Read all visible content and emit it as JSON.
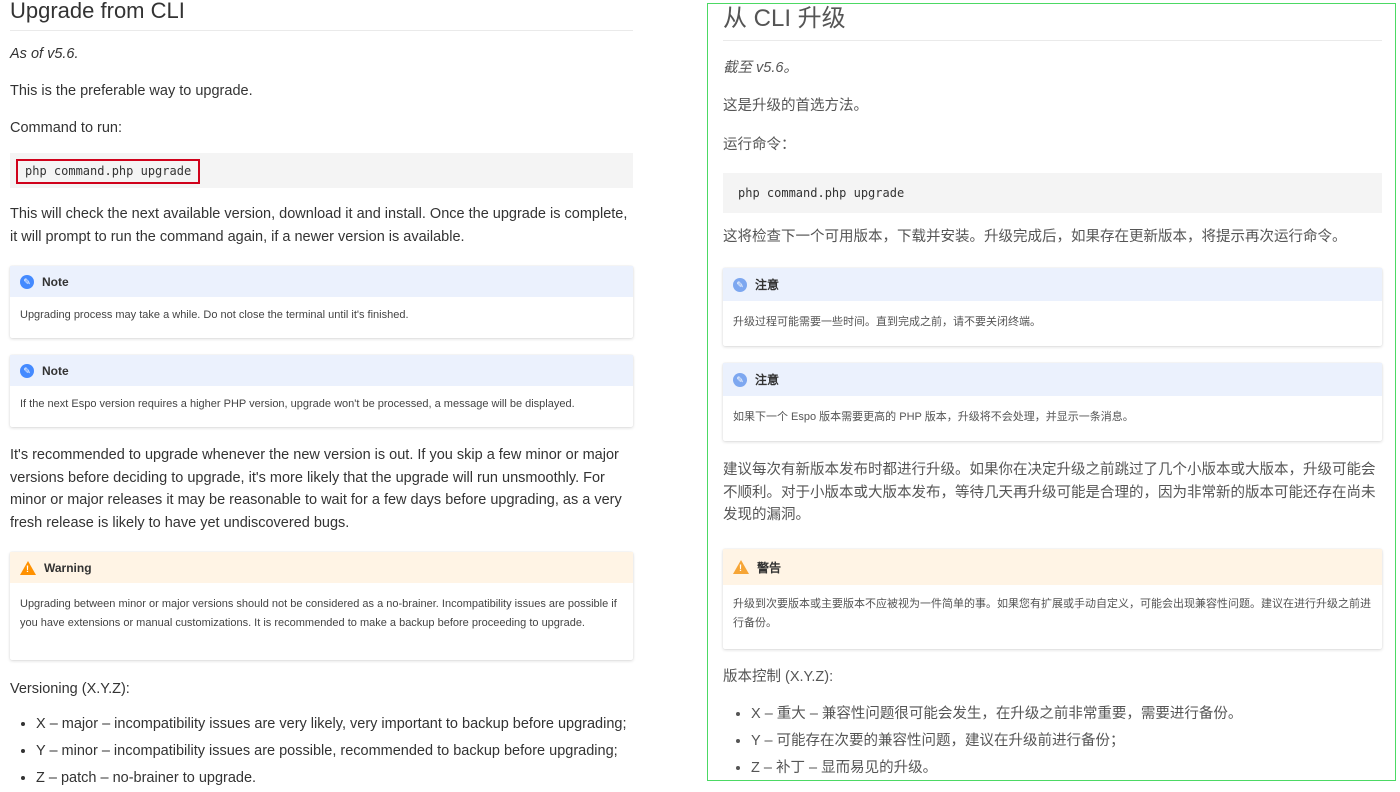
{
  "english": {
    "title": "Upgrade from CLI",
    "as_of": "As of v5.6.",
    "preferable": "This is the preferable way to upgrade.",
    "command_to_run": "Command to run:",
    "command": "php command.php upgrade",
    "check_text": "This will check the next available version, download it and install. Once the upgrade is complete, it will prompt to run the command again, if a newer version is available.",
    "note1": {
      "title": "Note",
      "body": "Upgrading process may take a while. Do not close the terminal until it's finished."
    },
    "note2": {
      "title": "Note",
      "body": "If the next Espo version requires a higher PHP version, upgrade won't be processed, a message will be displayed."
    },
    "recommend": "It's recommended to upgrade whenever the new version is out. If you skip a few minor or major versions before deciding to upgrade, it's more likely that the upgrade will run unsmoothly. For minor or major releases it may be reasonable to wait for a few days before upgrading, as a very fresh release is likely to have yet undiscovered bugs.",
    "warning": {
      "title": "Warning",
      "body": "Upgrading between minor or major versions should not be considered as a no-brainer. Incompatibility issues are possible if you have extensions or manual customizations. It is recommended to make a backup before proceeding to upgrade."
    },
    "versioning": "Versioning (X.Y.Z):",
    "list": [
      "X – major – incompatibility issues are very likely, very important to backup before upgrading;",
      "Y – minor – incompatibility issues are possible, recommended to backup before upgrading;",
      "Z – patch – no-brainer to upgrade."
    ]
  },
  "chinese": {
    "title": "从 CLI 升级",
    "as_of": "截至 v5.6。",
    "preferable": "这是升级的首选方法。",
    "command_to_run": "运行命令：",
    "command": "php command.php upgrade",
    "check_text": "这将检查下一个可用版本，下载并安装。升级完成后，如果存在更新版本，将提示再次运行命令。",
    "note1": {
      "title": "注意",
      "body": "升级过程可能需要一些时间。直到完成之前，请不要关闭终端。"
    },
    "note2": {
      "title": "注意",
      "body": "如果下一个 Espo 版本需要更高的 PHP 版本，升级将不会处理，并显示一条消息。"
    },
    "recommend": "建议每次有新版本发布时都进行升级。如果你在决定升级之前跳过了几个小版本或大版本，升级可能会不顺利。对于小版本或大版本发布，等待几天再升级可能是合理的，因为非常新的版本可能还存在尚未发现的漏洞。",
    "warning": {
      "title": "警告",
      "body": "升级到次要版本或主要版本不应被视为一件简单的事。如果您有扩展或手动自定义，可能会出现兼容性问题。建议在进行升级之前进行备份。"
    },
    "versioning": "版本控制 (X.Y.Z):",
    "list": [
      "X – 重大 – 兼容性问题很可能会发生，在升级之前非常重要，需要进行备份。",
      "Y – 可能存在次要的兼容性问题，建议在升级前进行备份；",
      "Z – 补丁 – 显而易见的升级。"
    ]
  },
  "colors": {
    "highlight_border": "#d0021b",
    "pane_border": "#4cd964",
    "note_header": "#ebf1fd",
    "warning_header": "#fff4e5"
  },
  "icons": {
    "note": "pencil-icon",
    "warning": "warning-triangle-icon"
  }
}
